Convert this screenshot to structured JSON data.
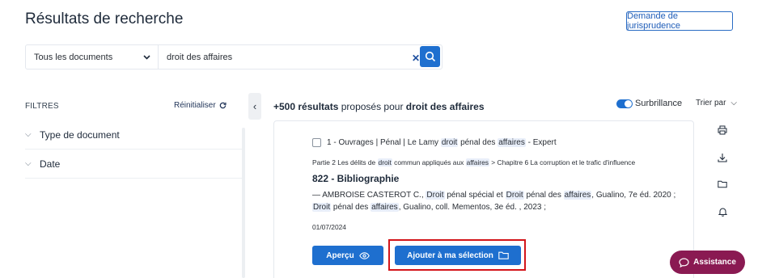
{
  "header": {
    "title": "Résultats de recherche",
    "jurisprudence_button": "Demande de jurisprudence"
  },
  "search": {
    "scope_select": "Tous les documents",
    "query": "droit des affaires"
  },
  "filters": {
    "label": "FILTRES",
    "reset_label": "Réinitialiser",
    "groups": [
      {
        "label": "Type de document"
      },
      {
        "label": "Date"
      }
    ]
  },
  "results": {
    "count_bold": "+500 résultats",
    "count_mid": "proposés pour",
    "count_query": "droit des affaires",
    "highlight_label": "Surbrillance",
    "sort_label": "Trier par",
    "highlight_enabled": true
  },
  "result": {
    "src_prefix": "1 - Ouvrages | Pénal | Le Lamy",
    "src_hl1": "droit",
    "src_mid": "pénal des",
    "src_hl2": "affaires",
    "src_suffix": "- Expert",
    "crumb_a": "Partie 2 Les délits de",
    "crumb_hl1": "droit",
    "crumb_b": "commun appliqués aux",
    "crumb_hl2": "affaires",
    "crumb_c": "> Chapitre 6 La corruption et le trafic d'influence",
    "title": "822 - Bibliographie",
    "bib1_a": "— AMBROISE CASTEROT C.,",
    "bib1_hl1": "Droit",
    "bib1_b": "pénal spécial et",
    "bib1_hl2": "Droit",
    "bib1_c": "pénal des",
    "bib1_hl3": "affaires",
    "bib1_d": ", Gualino, 7e éd. 2020 ;",
    "bib2_hl1": "Droit",
    "bib2_a": "pénal des",
    "bib2_hl2": "affaires",
    "bib2_b": ", Gualino, coll. Mementos, 3e éd. , 2023 ;",
    "date": "01/07/2024",
    "preview_button": "Aperçu",
    "add_button": "Ajouter à ma sélection"
  },
  "tools": [
    "print-icon",
    "download-icon",
    "folder-icon",
    "bell-icon"
  ],
  "assistance": {
    "label": "Assistance"
  },
  "colors": {
    "primary": "#1e6fcf",
    "assist": "#8a1a52",
    "highlight_frame": "#d3151a"
  }
}
